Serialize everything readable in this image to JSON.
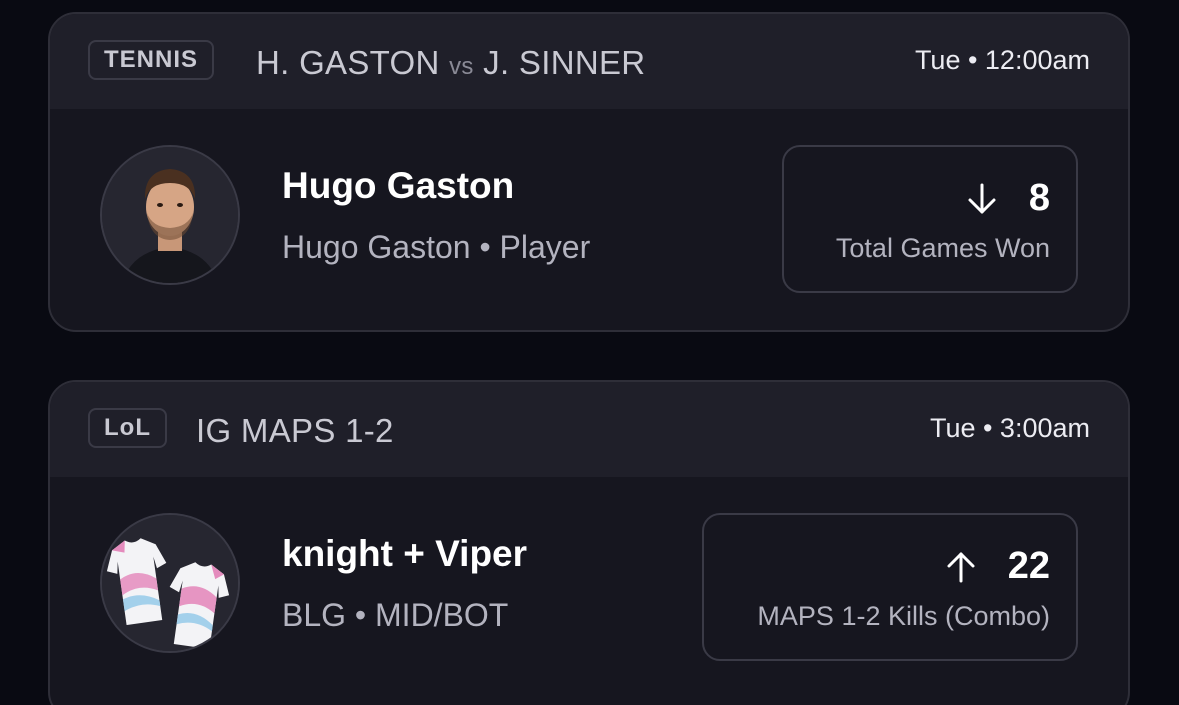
{
  "cards": [
    {
      "tag": "TENNIS",
      "title_left": "H. GASTON",
      "title_vs": "vs",
      "title_right": "J. SINNER",
      "time": "Tue • 12:00am",
      "avatar_icon": "player-headshot-icon",
      "name": "Hugo Gaston",
      "subtitle": "Hugo Gaston • Player",
      "direction": "down",
      "direction_icon": "arrow-down-icon",
      "value": "8",
      "stat_label": "Total Games Won"
    },
    {
      "tag": "LoL",
      "title_left": "IG MAPS 1-2",
      "time": "Tue • 3:00am",
      "avatar_icon": "team-jerseys-icon",
      "name": "knight + Viper",
      "subtitle": "BLG • MID/BOT",
      "direction": "up",
      "direction_icon": "arrow-up-icon",
      "value": "22",
      "stat_label": "MAPS 1-2 Kills (Combo)"
    }
  ],
  "colors": {
    "background": "#090a12",
    "card": "#16161f",
    "header": "#1f1f29",
    "border": "#3a3a46"
  }
}
